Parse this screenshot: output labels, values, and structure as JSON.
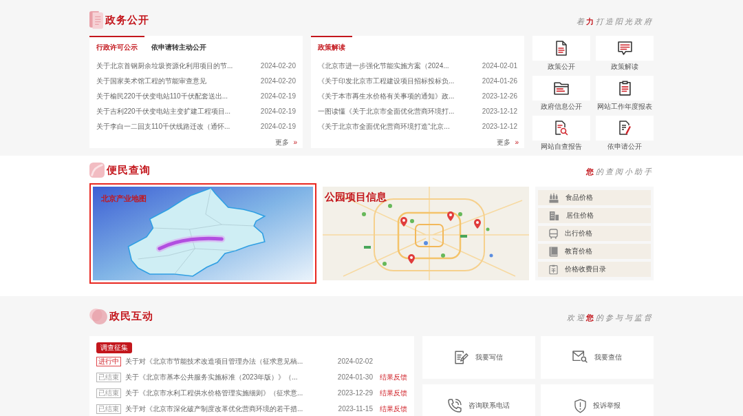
{
  "open_government": {
    "title": "政务公开",
    "slogan": "着**力**打造阳光政府",
    "panels": [
      {
        "tabs": [
          {
            "label": "行政许可公示",
            "selected": true
          },
          {
            "label": "依申请转主动公开",
            "selected": false
          }
        ],
        "rows": [
          {
            "title": "关于北京首钢厨余垃圾资源化利用项目的节...",
            "date": "2024-02-20"
          },
          {
            "title": "关于国家美术馆工程的节能审查意见",
            "date": "2024-02-20"
          },
          {
            "title": "关于榆民220千伏变电站110千伏配套送出...",
            "date": "2024-02-19"
          },
          {
            "title": "关于吉利220千伏变电站主变扩建工程项目...",
            "date": "2024-02-19"
          },
          {
            "title": "关于李白一二回支110千伏线路迁改（通怀...",
            "date": "2024-02-19"
          }
        ],
        "more": {
          "label": "更多",
          "arrow": "»"
        }
      },
      {
        "tabs": [
          {
            "label": "政策解读",
            "selected": true
          }
        ],
        "rows": [
          {
            "title": "《北京市进一步强化节能实施方案（2024...",
            "date": "2024-02-01"
          },
          {
            "title": "《关于印发北京市工程建设项目招标投标负...",
            "date": "2024-01-26"
          },
          {
            "title": "《关于本市再生水价格有关事项的通知》政...",
            "date": "2023-12-26"
          },
          {
            "title": "一图读懂《关于北京市全面优化营商环境打...",
            "date": "2023-12-12"
          },
          {
            "title": "《关于北京市全面优化营商环境打造“北京...",
            "date": "2023-12-12"
          }
        ],
        "more": {
          "label": "更多",
          "arrow": "»"
        }
      }
    ],
    "shortcuts": [
      "政策公开",
      "政策解读",
      "政府信息公开",
      "网站工作年度报表",
      "网站自查报告",
      "依申请公开"
    ]
  },
  "services": {
    "title": "便民查询",
    "slogan": "**您**的查阅小助手",
    "maps": [
      {
        "title": "北京产业地图",
        "selected": true
      },
      {
        "title": "公园项目信息",
        "selected": false
      }
    ],
    "prices": [
      "食品价格",
      "居住价格",
      "出行价格",
      "教育价格",
      "价格收费目录"
    ]
  },
  "interaction": {
    "title": "政民互动",
    "slogan": "欢迎**您**的参与与监督",
    "survey": {
      "tabs": [
        {
          "label": "调查征集",
          "selected": true
        }
      ],
      "rows": [
        {
          "tag": {
            "text": "进行中",
            "active": true
          },
          "title": "关于对《北京市节能技术改造项目管理办法（征求意见稿...",
          "date": "2024-02-02"
        },
        {
          "tag": {
            "text": "已结束",
            "active": false
          },
          "title": "关于《北京市基本公共服务实施标准（2023年版）》（...",
          "date": "2024-01-30",
          "feedback": "结果反馈"
        },
        {
          "tag": {
            "text": "已结束",
            "active": false
          },
          "title": "关于《北京市水利工程供水价格管理实施细则》（征求意...",
          "date": "2023-12-29",
          "feedback": "结果反馈"
        },
        {
          "tag": {
            "text": "已结束",
            "active": false
          },
          "title": "关于对《北京市深化破产制度改革优化营商环境的若干措...",
          "date": "2023-11-15",
          "feedback": "结果反馈"
        }
      ]
    },
    "actions": [
      "我要写信",
      "我要查信",
      "咨询联系电话",
      "投诉举报"
    ]
  }
}
